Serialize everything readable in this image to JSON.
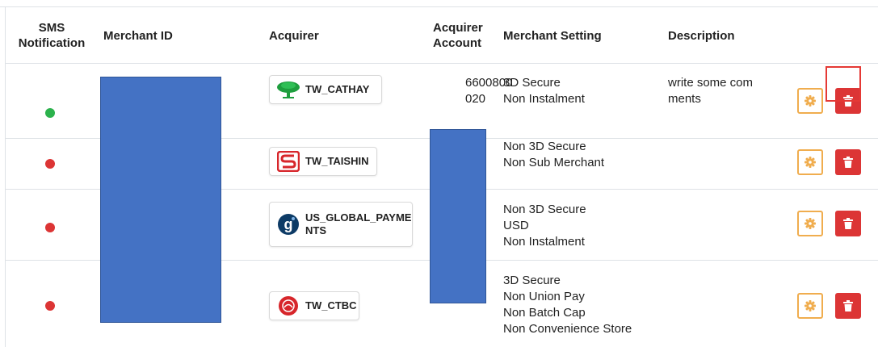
{
  "table": {
    "headers": {
      "sms": "SMS\nNotification",
      "merchant_id": "Merchant ID",
      "acquirer": "Acquirer",
      "acquirer_account": "Acquirer\nAccount",
      "merchant_setting": "Merchant Setting",
      "description": "Description"
    },
    "rows": [
      {
        "sms_status": "enabled",
        "acquirer": "TW_CATHAY",
        "acquirer_account": "6600800\n020",
        "merchant_setting": "3D Secure\nNon Instalment",
        "description": "write some com\nments"
      },
      {
        "sms_status": "disabled",
        "acquirer": "TW_TAISHIN",
        "acquirer_account": "",
        "merchant_setting": "Non 3D Secure\nNon Sub Merchant",
        "description": ""
      },
      {
        "sms_status": "disabled",
        "acquirer": "US_GLOBAL_PAYME\nNTS",
        "acquirer_account": "",
        "merchant_setting": "Non 3D Secure\nUSD\nNon Instalment",
        "description": ""
      },
      {
        "sms_status": "disabled",
        "acquirer": "TW_CTBC",
        "acquirer_account": "",
        "merchant_setting": "3D Secure\nNon Union Pay\nNon Batch Cap\nNon Convenience Store",
        "description": ""
      }
    ]
  },
  "icons": {
    "settings": "gear-icon",
    "delete": "trash-icon",
    "sms_enabled": "status-dot-green",
    "sms_disabled": "status-dot-red"
  },
  "colors": {
    "sms_enabled": "#2bb24c",
    "sms_disabled": "#dc3535",
    "settings_button": "#f0ad4e",
    "delete_button": "#dc3535",
    "highlight": "#e53935",
    "redaction": "#4472c4"
  }
}
